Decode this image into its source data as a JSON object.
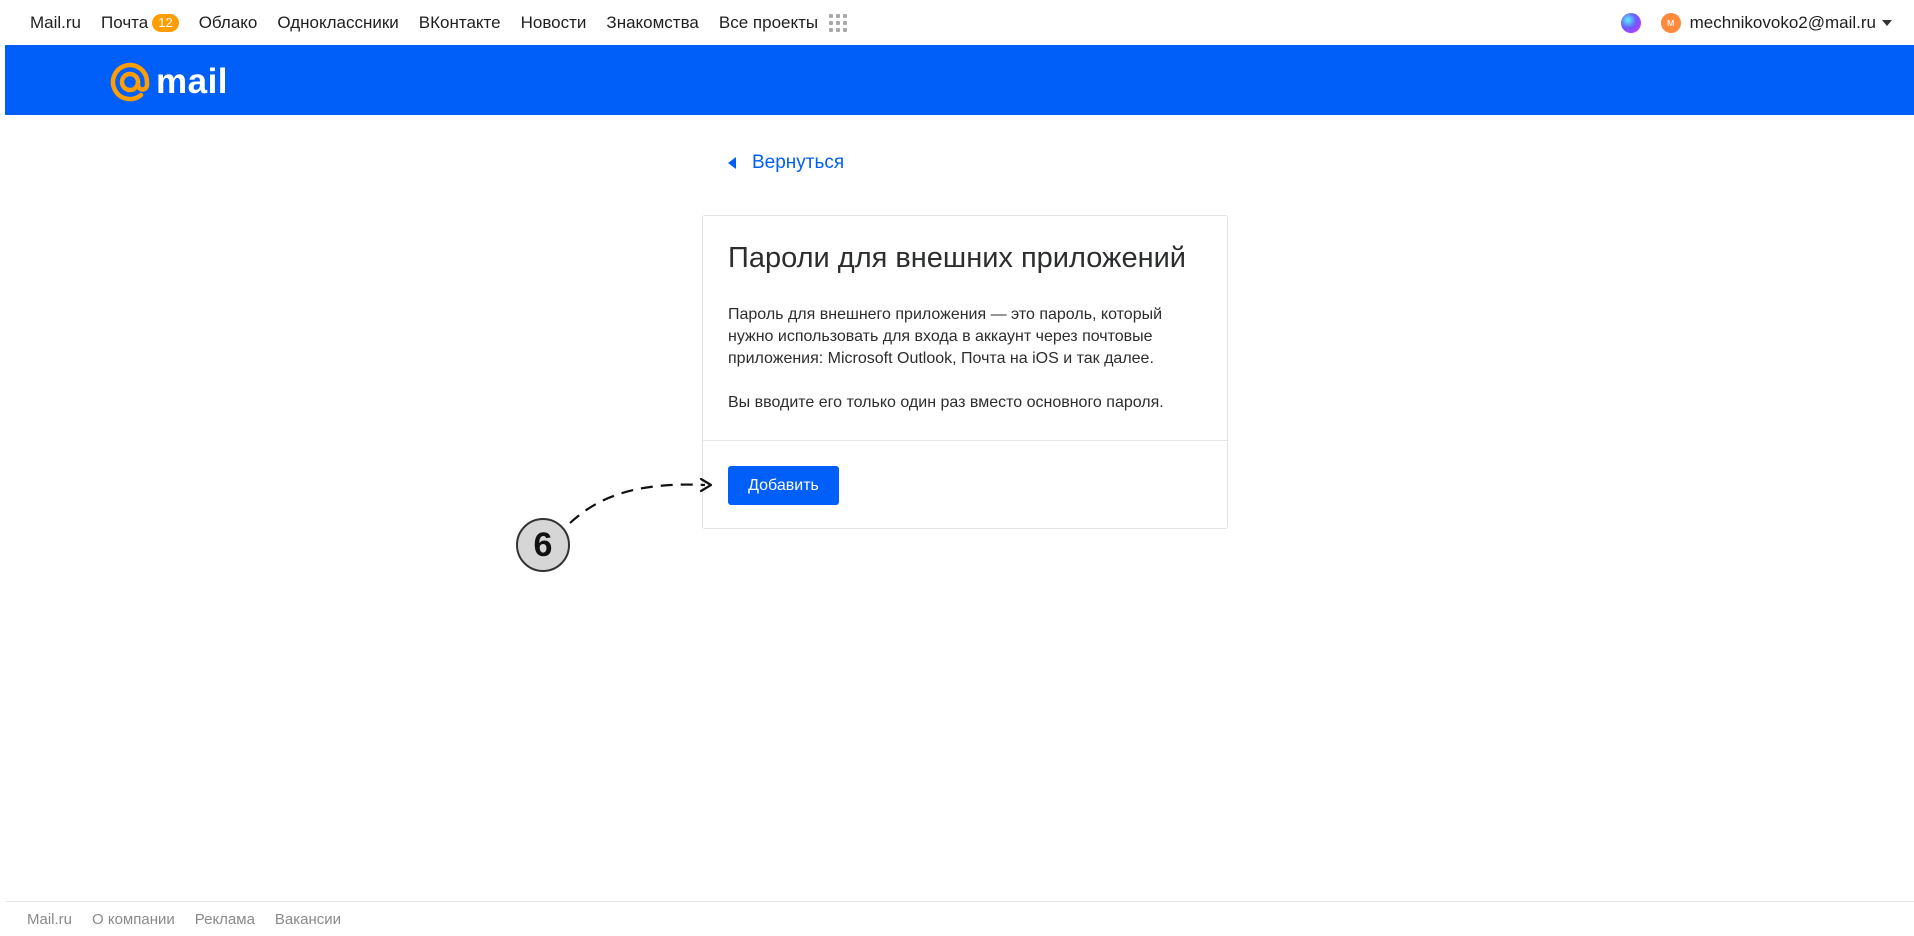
{
  "portal_nav": {
    "links": [
      {
        "label": "Mail.ru"
      },
      {
        "label": "Почта",
        "badge": "12"
      },
      {
        "label": "Облако"
      },
      {
        "label": "Одноклассники"
      },
      {
        "label": "ВКонтакте"
      },
      {
        "label": "Новости"
      },
      {
        "label": "Знакомства"
      },
      {
        "label": "Все проекты"
      }
    ]
  },
  "account": {
    "avatar_letter": "м",
    "email": "mechnikovoko2@mail.ru"
  },
  "brand": {
    "logo_text": "mail"
  },
  "back_link": {
    "label": "Вернуться"
  },
  "card": {
    "title": "Пароли для внешних приложений",
    "paragraph_1": "Пароль для внешнего приложения — это пароль, который нужно использовать для входа в аккаунт через почтовые приложения: Microsoft Outlook, Почта на iOS и так далее.",
    "paragraph_2": "Вы вводите его только один раз вместо основного пароля.",
    "add_button": "Добавить"
  },
  "annotation": {
    "step_number": "6"
  },
  "footer": {
    "links": [
      "Mail.ru",
      "О компании",
      "Реклама",
      "Вакансии"
    ]
  },
  "colors": {
    "brand_blue": "#005ff9",
    "badge_orange": "#ff9e00",
    "logo_orange": "#ff9e00",
    "avatar_orange": "#ff8a3d"
  }
}
